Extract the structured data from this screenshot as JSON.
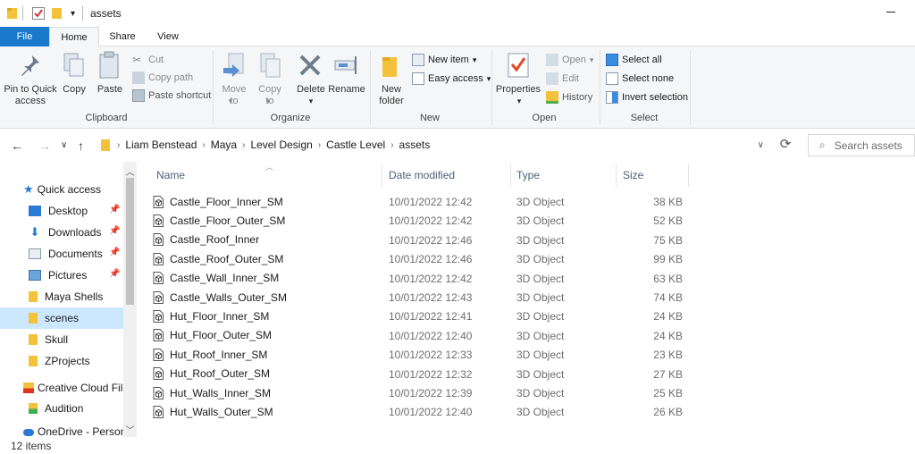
{
  "window": {
    "title": "assets"
  },
  "ribbon_tabs": [
    "File",
    "Home",
    "Share",
    "View"
  ],
  "clipboard": {
    "pin_label": "Pin to Quick access",
    "copy_label": "Copy",
    "paste_label": "Paste",
    "cut_label": "Cut",
    "copy_path_label": "Copy path",
    "paste_shortcut_label": "Paste shortcut",
    "group_label": "Clipboard"
  },
  "organize": {
    "move_label": "Move to",
    "copy_to_label": "Copy to",
    "delete_label": "Delete",
    "rename_label": "Rename",
    "group_label": "Organize"
  },
  "new_group": {
    "new_folder_label": "New folder",
    "new_item_label": "New item",
    "easy_access_label": "Easy access",
    "group_label": "New"
  },
  "open_group": {
    "properties_label": "Properties",
    "open_label": "Open",
    "edit_label": "Edit",
    "history_label": "History",
    "group_label": "Open"
  },
  "select_group": {
    "select_all_label": "Select all",
    "select_none_label": "Select none",
    "invert_label": "Invert selection",
    "group_label": "Select"
  },
  "breadcrumb": [
    "Liam Benstead",
    "Maya",
    "Level Design",
    "Castle Level",
    "assets"
  ],
  "search": {
    "placeholder": "Search assets"
  },
  "nav": {
    "items": [
      {
        "label": "Quick access",
        "icon": "star-icon"
      },
      {
        "label": "Desktop",
        "icon": "desktop-icon",
        "pinned": true
      },
      {
        "label": "Downloads",
        "icon": "download-icon",
        "pinned": true
      },
      {
        "label": "Documents",
        "icon": "documents-icon",
        "pinned": true
      },
      {
        "label": "Pictures",
        "icon": "pictures-icon",
        "pinned": true
      },
      {
        "label": "Maya Shells",
        "icon": "folder-icon"
      },
      {
        "label": "scenes",
        "icon": "folder-icon",
        "selected": true
      },
      {
        "label": "Skull",
        "icon": "folder-icon"
      },
      {
        "label": "ZProjects",
        "icon": "folder-icon"
      },
      {
        "label": "Creative Cloud Files",
        "icon": "creative-cloud-icon"
      },
      {
        "label": "Audition",
        "icon": "audition-icon"
      },
      {
        "label": "OneDrive - Personal",
        "icon": "onedrive-icon"
      }
    ]
  },
  "columns": {
    "name": "Name",
    "date": "Date modified",
    "type": "Type",
    "size": "Size"
  },
  "files": [
    {
      "name": "Castle_Floor_Inner_SM",
      "date": "10/01/2022 12:42",
      "type": "3D Object",
      "size": "38 KB"
    },
    {
      "name": "Castle_Floor_Outer_SM",
      "date": "10/01/2022 12:42",
      "type": "3D Object",
      "size": "52 KB"
    },
    {
      "name": "Castle_Roof_Inner",
      "date": "10/01/2022 12:46",
      "type": "3D Object",
      "size": "75 KB"
    },
    {
      "name": "Castle_Roof_Outer_SM",
      "date": "10/01/2022 12:46",
      "type": "3D Object",
      "size": "99 KB"
    },
    {
      "name": "Castle_Wall_Inner_SM",
      "date": "10/01/2022 12:42",
      "type": "3D Object",
      "size": "63 KB"
    },
    {
      "name": "Castle_Walls_Outer_SM",
      "date": "10/01/2022 12:43",
      "type": "3D Object",
      "size": "74 KB"
    },
    {
      "name": "Hut_Floor_Inner_SM",
      "date": "10/01/2022 12:41",
      "type": "3D Object",
      "size": "24 KB"
    },
    {
      "name": "Hut_Floor_Outer_SM",
      "date": "10/01/2022 12:40",
      "type": "3D Object",
      "size": "24 KB"
    },
    {
      "name": "Hut_Roof_Inner_SM",
      "date": "10/01/2022 12:33",
      "type": "3D Object",
      "size": "23 KB"
    },
    {
      "name": "Hut_Roof_Outer_SM",
      "date": "10/01/2022 12:32",
      "type": "3D Object",
      "size": "27 KB"
    },
    {
      "name": "Hut_Walls_Inner_SM",
      "date": "10/01/2022 12:39",
      "type": "3D Object",
      "size": "25 KB"
    },
    {
      "name": "Hut_Walls_Outer_SM",
      "date": "10/01/2022 12:40",
      "type": "3D Object",
      "size": "26 KB"
    }
  ],
  "status": {
    "items_count": "12 items"
  },
  "colors": {
    "accent": "#1979ca",
    "selection": "#cce8ff",
    "folder": "#f3c13a"
  }
}
